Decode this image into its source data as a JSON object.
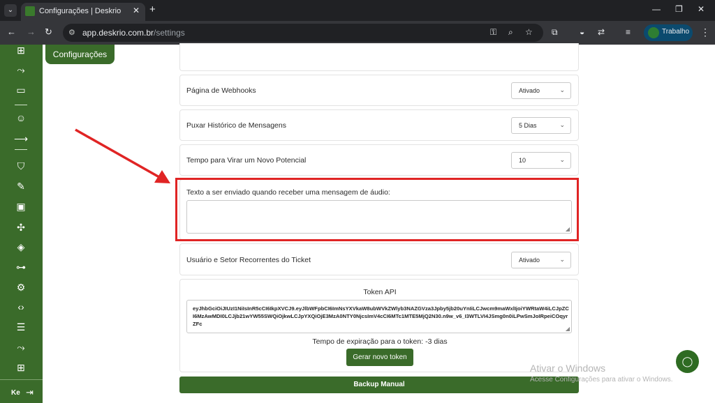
{
  "browser": {
    "tab_title": "Configurações | Deskrio",
    "url_host": "app.deskrio.com.br",
    "url_path": "/settings",
    "profile_name": "Trabalho"
  },
  "page": {
    "tab_label": "Configurações"
  },
  "settings": {
    "webhooks": {
      "label": "Página de Webhooks",
      "value": "Ativado"
    },
    "history": {
      "label": "Puxar Histórico de Mensagens",
      "value": "5 Dias"
    },
    "potential": {
      "label": "Tempo para Virar um Novo Potencial",
      "value": "10"
    },
    "audio_text": {
      "label": "Texto a ser enviado quando receber uma mensagem de áudio:",
      "value": ""
    },
    "recurrent": {
      "label": "Usuário e Setor Recorrentes do Ticket",
      "value": "Ativado"
    }
  },
  "token": {
    "title": "Token API",
    "value": "eyJhbGciOiJIUzI1NiIsInR5cCI6IkpXVCJ9.eyJlbWFpbCI6ImNsYXVkaW8ubWVkZWlyb3NAZGVza3Jpby5jb20uYnIiLCJwcm9maWxlIjoiYWRtaW4iLCJpZCI6MzAwMDI0LCJjb21wYW55SWQiOjkwLCJpYXQiOjE3MzA0NTY0NjcsImV4cCI6MTc1MTE5MjQ2N30.n9w_v6_I3WTLVI4JSmg0n0iLPwSmJoIRpeiCOqyrZFc",
    "expiry_text": "Tempo de expiração para o token: -3 dias",
    "generate_label": "Gerar novo token"
  },
  "backup_label": "Backup Manual",
  "sidebar": {
    "user_initials": "Ke"
  },
  "watermark": {
    "title": "Ativar o Windows",
    "subtitle": "Acesse Configurações para ativar o Windows."
  },
  "colors": {
    "brand": "#3a6b2a",
    "highlight": "#e02424"
  },
  "icons": [
    "chat-plus-icon",
    "route-icon",
    "message-icon",
    "users-icon",
    "arrow-right-icon",
    "shield-icon",
    "edit-icon",
    "robot-icon",
    "webhook-icon",
    "tags-icon",
    "sitemap-icon",
    "gear-icon",
    "code-icon",
    "checklist-icon",
    "route-icon",
    "grid-icon",
    "logout-icon"
  ]
}
